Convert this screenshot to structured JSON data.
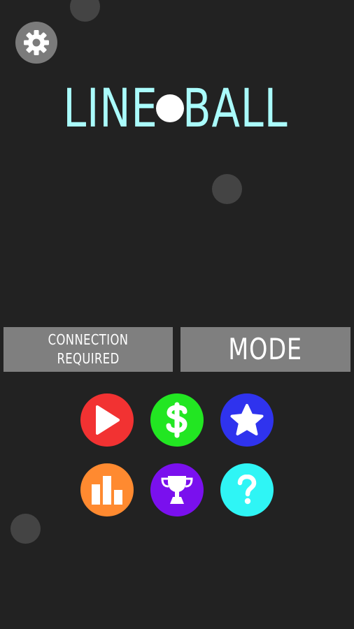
{
  "title": {
    "left": "LINE",
    "right": "BALL"
  },
  "buttons": {
    "connection_line1": "CONNECTION",
    "connection_line2": "REQUIRED",
    "mode": "MODE"
  },
  "icons": {
    "settings": "gear-icon",
    "play": "play-icon",
    "shop": "dollar-icon",
    "rate": "star-icon",
    "stats": "bar-chart-icon",
    "trophy": "trophy-icon",
    "help": "question-icon"
  },
  "colors": {
    "background": "#222222",
    "title": "#aafcfc",
    "panel_button": "#7f7f7f",
    "play": "#f23232",
    "shop": "#22e622",
    "rate": "#2f33ee",
    "stats": "#ff8a30",
    "trophy": "#7a10ee",
    "help": "#2ff5f5",
    "settings": "#7b7b7b",
    "decor_ball": "#444444"
  }
}
